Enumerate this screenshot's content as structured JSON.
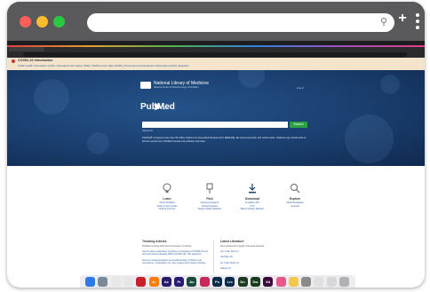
{
  "browser": {
    "url_value": "",
    "new_tab_symbol": "+"
  },
  "gov_banner": {
    "title": "COVID-19 Information",
    "links": "Public health information (CDC) | Research information (NIH) | SARS-CoV-2 data (NCBI) | Prevention and treatment information (HHS) | Español"
  },
  "header": {
    "org_name": "National Library of Medicine",
    "org_sub": "National Center for Biotechnology Information",
    "login": "Log in"
  },
  "hero": {
    "brand": "PubMed",
    "brand_suffix": ".gov",
    "search_placeholder": "",
    "search_button": "Search",
    "advanced": "Advanced",
    "description": "PubMed® comprises more than 35 million citations for biomedical literature from MEDLINE, life science journals, and online books. Citations may include links to full text content from PubMed Central and publisher web sites."
  },
  "features": [
    {
      "title": "Learn",
      "links": [
        "About PubMed",
        "FAQs & User Guide",
        "Finding Full Text"
      ],
      "icon": "learn-icon"
    },
    {
      "title": "Find",
      "links": [
        "Advanced Search",
        "Clinical Queries",
        "Single Citation Matcher"
      ],
      "icon": "find-icon"
    },
    {
      "title": "Download",
      "links": [
        "E-utilities API",
        "FTP",
        "Batch Citation Matcher"
      ],
      "icon": "download-icon"
    },
    {
      "title": "Explore",
      "links": [
        "MeSH Database",
        "Journals"
      ],
      "icon": "explore-icon"
    }
  ],
  "trending": {
    "heading": "Trending Articles",
    "description": "PubMed records with recent increases in activity",
    "items": [
      "Severe acute respiratory syndrome coronavirus 2 (SARS-CoV-2) and coronavirus disease-2019 (COVID-19): The epidemic...",
      "Genomic characterisation and epidemiology of 2019 novel coronavirus: implications for virus origins and receptor binding..."
    ]
  },
  "latest": {
    "heading": "Latest Literature",
    "description": "New articles from highly accessed journals",
    "items": [
      "Am J Clin Nutr (1)",
      "Cell Rep (5)",
      "Int J Clin Pract (1)",
      "Nature (4)"
    ]
  },
  "dock": {
    "apps": [
      {
        "label": "",
        "color": "#2e7be8",
        "icon": "finder-icon"
      },
      {
        "label": "",
        "color": "#7a8a98",
        "icon": "launchpad-icon"
      },
      {
        "label": "",
        "color": "#e8e8e8",
        "icon": "chrome-icon"
      },
      {
        "label": "",
        "color": "#e6e6e6",
        "icon": "safari-icon"
      },
      {
        "label": "",
        "color": "#c8202a",
        "icon": "acrobat-icon"
      },
      {
        "label": "Ai",
        "color": "#ff7c00",
        "icon": "illustrator-icon"
      },
      {
        "label": "Ae",
        "color": "#2b1b6e",
        "icon": "after-effects-icon"
      },
      {
        "label": "Pr",
        "color": "#2b1b6e",
        "icon": "premiere-icon"
      },
      {
        "label": "Au",
        "color": "#1a4a3a",
        "icon": "audition-icon"
      },
      {
        "label": "",
        "color": "#c9285a",
        "icon": "indesign-icon"
      },
      {
        "label": "Ps",
        "color": "#0a2a4a",
        "icon": "photoshop-icon"
      },
      {
        "label": "Lrc",
        "color": "#0a2a4a",
        "icon": "lightroom-icon"
      },
      {
        "label": "Dn",
        "color": "#1b3a1e",
        "icon": "dimension-icon"
      },
      {
        "label": "Dw",
        "color": "#1b3a1e",
        "icon": "dreamweaver-icon"
      },
      {
        "label": "Xd",
        "color": "#3b0a3a",
        "icon": "xd-icon"
      },
      {
        "label": "",
        "color": "#e8578a",
        "icon": "app-icon"
      },
      {
        "label": "",
        "color": "#f2c94c",
        "icon": "notes-icon"
      },
      {
        "label": "",
        "color": "#8a8a8a",
        "icon": "settings-icon"
      },
      {
        "label": "",
        "color": "#e0e0e0",
        "icon": "preview-icon"
      },
      {
        "label": "",
        "color": "#d8d8d8",
        "icon": "folder-icon"
      },
      {
        "label": "",
        "color": "#b0b0b0",
        "icon": "trash-icon"
      }
    ]
  }
}
